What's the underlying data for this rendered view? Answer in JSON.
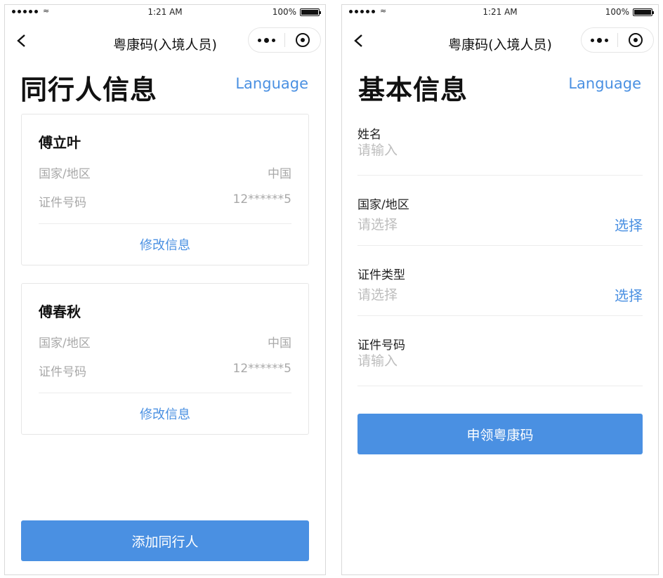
{
  "status_bar": {
    "time": "1:21 AM",
    "battery": "100%"
  },
  "nav": {
    "title": "粤康码(入境人员)"
  },
  "left_page": {
    "heading": "同行人信息",
    "language_label": "Language",
    "companions": [
      {
        "name": "傅立叶",
        "country_label": "国家/地区",
        "country_value": "中国",
        "id_label": "证件号码",
        "id_value": "12******5",
        "edit_label": "修改信息"
      },
      {
        "name": "傅春秋",
        "country_label": "国家/地区",
        "country_value": "中国",
        "id_label": "证件号码",
        "id_value": "12******5",
        "edit_label": "修改信息"
      }
    ],
    "add_button_label": "添加同行人"
  },
  "right_page": {
    "heading": "基本信息",
    "language_label": "Language",
    "fields": {
      "name": {
        "label": "姓名",
        "placeholder": "请输入"
      },
      "country": {
        "label": "国家/地区",
        "placeholder": "请选择",
        "action": "选择"
      },
      "id_type": {
        "label": "证件类型",
        "placeholder": "请选择",
        "action": "选择"
      },
      "id_number": {
        "label": "证件号码",
        "placeholder": "请输入"
      }
    },
    "submit_label": "申领粤康码"
  },
  "colors": {
    "accent": "#4a90e2",
    "placeholder": "#bdbdbd",
    "muted": "#a8a8a8"
  },
  "icons": [
    "back-arrow-icon",
    "more-dots-icon",
    "mini-program-close-icon",
    "signal-icon",
    "wifi-icon",
    "battery-icon"
  ]
}
